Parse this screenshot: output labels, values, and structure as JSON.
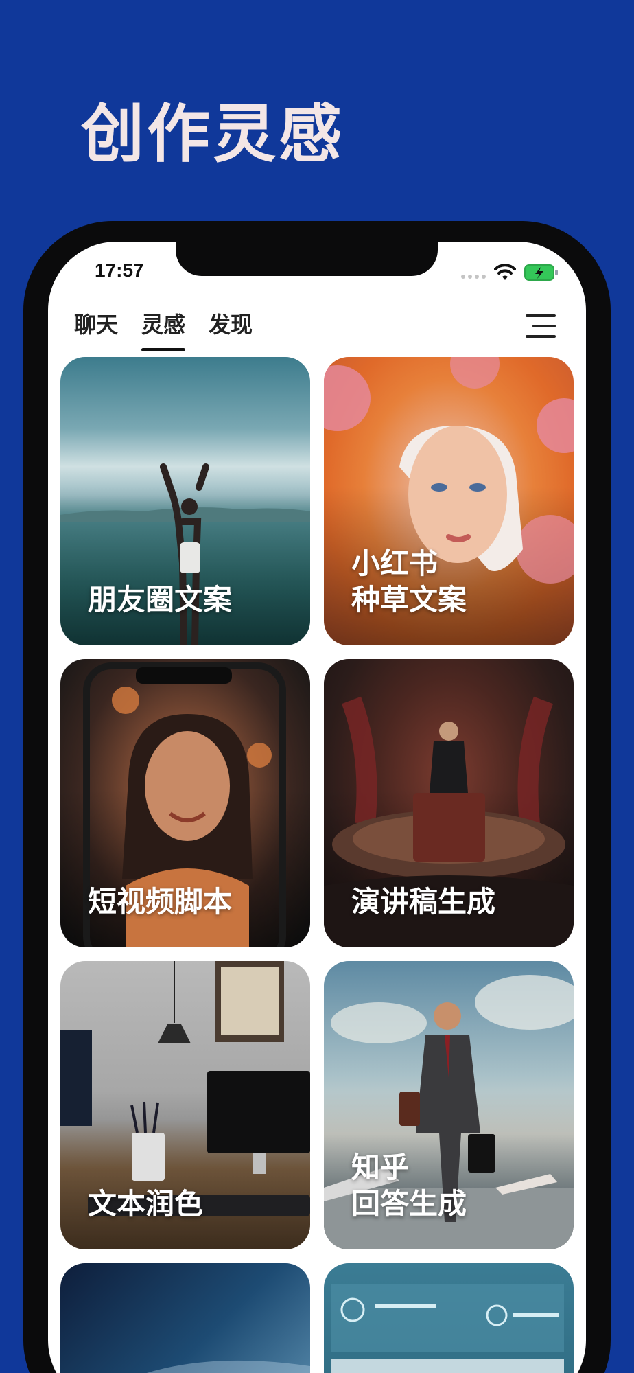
{
  "hero": {
    "title": "创作灵感"
  },
  "status_bar": {
    "time": "17:57"
  },
  "tabs": [
    {
      "label": "聊天",
      "active": false
    },
    {
      "label": "灵感",
      "active": true
    },
    {
      "label": "发现",
      "active": false
    }
  ],
  "cards": [
    {
      "label": "朋友圈文案"
    },
    {
      "label": "小红书\n种草文案"
    },
    {
      "label": "短视频脚本"
    },
    {
      "label": "演讲稿生成"
    },
    {
      "label": "文本润色"
    },
    {
      "label": "知乎\n回答生成"
    }
  ],
  "icons": {
    "menu": "hamburger-menu-icon",
    "wifi": "wifi-icon",
    "battery": "battery-charging-icon"
  },
  "colors": {
    "background": "#10389a",
    "hero_title": "#f3e6e6",
    "battery": "#34c759"
  }
}
